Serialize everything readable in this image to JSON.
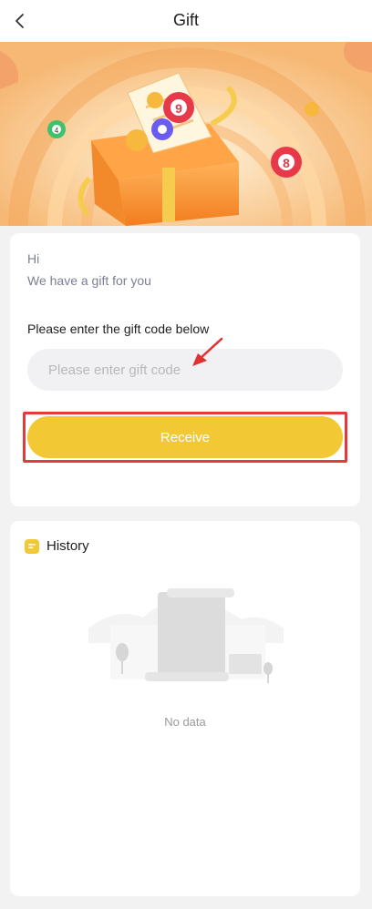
{
  "header": {
    "title": "Gift",
    "back_icon": "chevron-left-icon"
  },
  "banner": {
    "ball_numbers": [
      "4",
      "9",
      "8"
    ]
  },
  "gift": {
    "greeting": "Hi",
    "message": "We have a gift for you",
    "code_label": "Please enter the gift code below",
    "code_value": "",
    "code_placeholder": "Please enter gift code",
    "receive_label": "Receive"
  },
  "history": {
    "title": "History",
    "icon": "history-icon",
    "empty_text": "No data"
  },
  "colors": {
    "accent": "#f2c935",
    "highlight_frame": "#e23a3a",
    "annotation_arrow": "#e03030",
    "page_bg": "#f2f2f2",
    "muted_text": "#7b7f93"
  }
}
